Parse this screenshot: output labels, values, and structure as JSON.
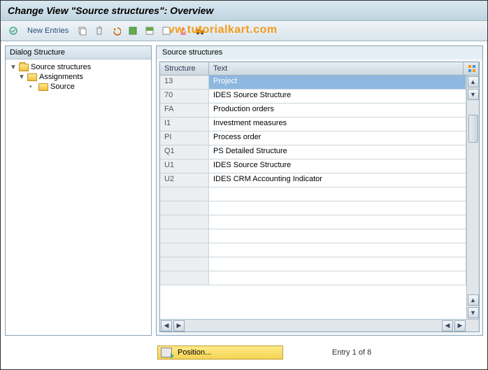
{
  "title": "Change View \"Source structures\": Overview",
  "toolbar": {
    "new_entries_label": "New Entries"
  },
  "watermark": "vw.tutorialkart.com",
  "tree": {
    "header": "Dialog Structure",
    "items": [
      {
        "label": "Source structures"
      },
      {
        "label": "Assignments"
      },
      {
        "label": "Source"
      }
    ]
  },
  "table": {
    "title": "Source structures",
    "columns": {
      "structure": "Structure",
      "text": "Text"
    },
    "rows": [
      {
        "structure": "13",
        "text": "Project"
      },
      {
        "structure": "70",
        "text": "IDES Source Structure"
      },
      {
        "structure": "FA",
        "text": "Production orders"
      },
      {
        "structure": "I1",
        "text": "Investment measures"
      },
      {
        "structure": "PI",
        "text": "Process order"
      },
      {
        "structure": "Q1",
        "text": "PS Detailed Structure"
      },
      {
        "structure": "U1",
        "text": "IDES Source Structure"
      },
      {
        "structure": "U2",
        "text": "IDES CRM Accounting Indicator"
      }
    ],
    "empty_rows": 7
  },
  "footer": {
    "position_label": "Position...",
    "entry_info": "Entry 1 of 8"
  }
}
